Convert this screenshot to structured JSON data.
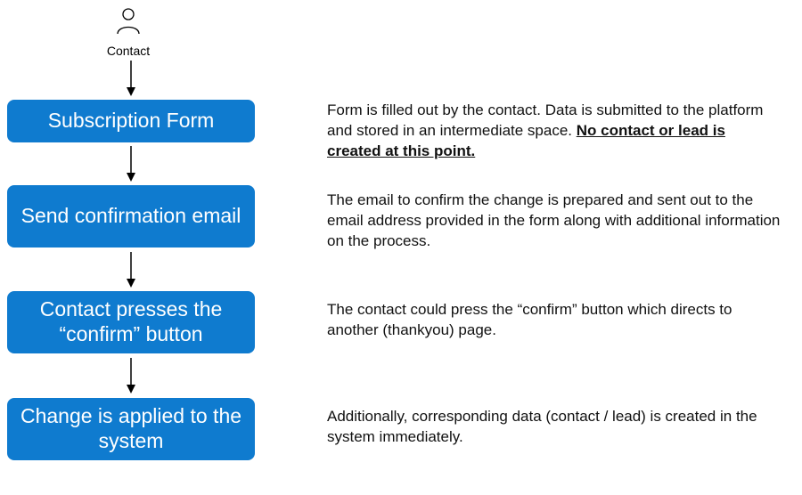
{
  "contact_label": "Contact",
  "steps": {
    "s1": {
      "title": "Subscription Form"
    },
    "s2": {
      "title": "Send confirmation email"
    },
    "s3": {
      "title": "Contact presses the “confirm” button"
    },
    "s4": {
      "title": "Change is applied to the system"
    }
  },
  "descriptions": {
    "d1_a": "Form is filled out by the contact. Data is submitted to the platform and stored in an intermediate space. ",
    "d1_b": "No contact or lead is created at this point.",
    "d2": "The email to confirm the change is prepared and sent out to the email address provided in the form along with additional information on the process.",
    "d3": "The contact could press the “confirm” button which directs to another (thankyou) page.",
    "d4": "Additionally, corresponding data (contact / lead) is created in the system immediately."
  },
  "colors": {
    "box": "#0f7bcf"
  }
}
